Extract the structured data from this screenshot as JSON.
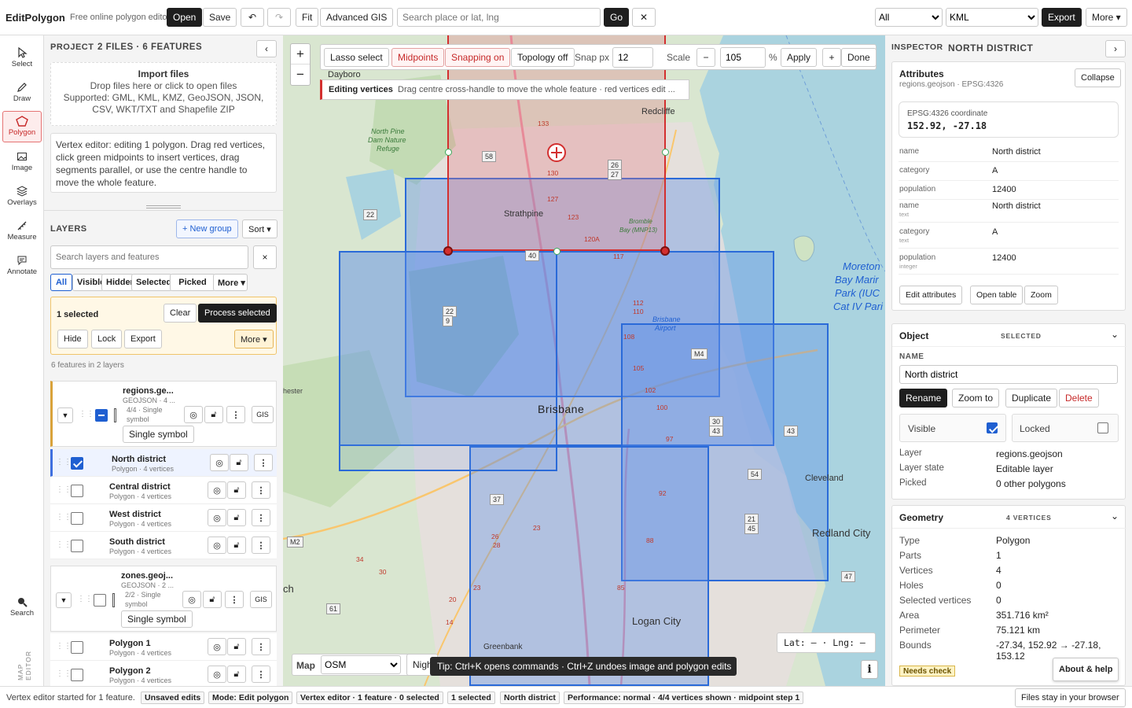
{
  "topbar": {
    "brand": "EditPolygon",
    "tagline": "Free online polygon editor",
    "open": "Open",
    "save": "Save",
    "undo": "↶",
    "redo": "↷",
    "fit": "Fit",
    "advanced": "Advanced GIS",
    "search_placeholder": "Search place or lat, lng",
    "go": "Go",
    "clear": "✕",
    "filter": "All",
    "format": "KML",
    "export": "Export",
    "more": "More ▾"
  },
  "rail": {
    "select": "Select",
    "draw": "Draw",
    "polygon": "Polygon",
    "image": "Image",
    "overlays": "Overlays",
    "measure": "Measure",
    "annotate": "Annotate",
    "search": "Search",
    "vertical": "MAP EDITOR"
  },
  "project": {
    "label": "PROJECT",
    "summary": "2 FILES · 6 FEATURES",
    "collapse": "‹",
    "import_title": "Import files",
    "import_line1": "Drop files here or click to open files",
    "import_line2": "Supported: GML, KML, KMZ, GeoJSON, JSON, CSV, WKT/TXT and Shapefile ZIP",
    "hint": "Vertex editor: editing 1 polygon. Drag red vertices, click green midpoints to insert vertices, drag segments parallel, or use the centre handle to move the whole feature."
  },
  "layers": {
    "label": "LAYERS",
    "new_group": "+ New group",
    "sort": "Sort ▾",
    "search_placeholder": "Search layers and features",
    "search_clear": "×",
    "filters": [
      "All",
      "Visible",
      "Hidden",
      "Selected",
      "Picked",
      "More ▾"
    ],
    "selected_count": "1 selected",
    "clear": "Clear",
    "process": "Process selected",
    "hide": "Hide",
    "lock": "Lock",
    "export": "Export",
    "more": "More ▾",
    "count_text": "6 features in 2 layers",
    "groups": [
      {
        "name": "regions.ge...",
        "meta": "GEOJSON · 4 ...",
        "meta2": "4/4 · Single",
        "meta3": "symbol",
        "symbol": "Single symbol",
        "gis": "GIS"
      },
      {
        "name": "zones.geoj...",
        "meta": "GEOJSON · 2 ...",
        "meta2": "2/2 · Single",
        "meta3": "symbol",
        "symbol": "Single symbol",
        "gis": "GIS"
      }
    ],
    "features": [
      {
        "name": "North district",
        "sub": "Polygon · 4 vertices"
      },
      {
        "name": "Central district",
        "sub": "Polygon · 4 vertices"
      },
      {
        "name": "West district",
        "sub": "Polygon · 4 vertices"
      },
      {
        "name": "South district",
        "sub": "Polygon · 4 vertices"
      },
      {
        "name": "Polygon 1",
        "sub": "Polygon · 4 vertices"
      },
      {
        "name": "Polygon 2",
        "sub": "Polygon · 4 vertices"
      }
    ]
  },
  "map": {
    "zoom_in": "+",
    "zoom_out": "−",
    "lasso": "Lasso select",
    "midpoints": "Midpoints",
    "snapping": "Snapping on",
    "topology": "Topology off",
    "snap_label": "Snap px",
    "snap_value": "12",
    "scale_label": "Scale",
    "scale_minus": "−",
    "scale_value": "105",
    "scale_unit": "%",
    "apply": "Apply",
    "plus": "+",
    "done": "Done",
    "editing_title": "Editing vertices",
    "editing_text": "Drag centre cross-handle to move the whole feature · red vertices edit ...",
    "coords": "Lat: — · Lng: —",
    "basemap_label": "Map",
    "basemap": "OSM",
    "night": "Nigh",
    "tip": "Tip: Ctrl+K opens commands · Ctrl+Z undoes image and polygon edits",
    "info": "i",
    "places": [
      "Dayboro",
      "Redcliffe",
      "Strathpine",
      "Brisbane",
      "Cleveland",
      "Redland City",
      "Logan City",
      "Greenbank",
      "Moreton",
      "Bay Marir",
      "Park (IUC",
      "Cat IV Pari",
      "North Pine",
      "Dam Nature",
      "Refuge",
      "Brisbane",
      "Airport",
      "Bromble",
      "Bay (MNP13)",
      "hester",
      "ch"
    ],
    "shields": [
      "58",
      "22",
      "26",
      "27",
      "40",
      "22",
      "9",
      "M4",
      "30",
      "43",
      "43",
      "54",
      "37",
      "21",
      "45",
      "M2",
      "61",
      "47",
      "133",
      "130",
      "127",
      "123",
      "120A",
      "117",
      "112",
      "110",
      "108",
      "105",
      "102",
      "100",
      "97",
      "92",
      "88",
      "85",
      "23",
      "26",
      "28",
      "34",
      "30",
      "23",
      "20",
      "14"
    ]
  },
  "inspector": {
    "label": "INSPECTOR",
    "title": "NORTH DISTRICT",
    "close": "›",
    "attr_title": "Attributes",
    "attr_sub": "regions.geojson · EPSG:4326",
    "collapse": "Collapse",
    "coord_label": "EPSG:4326 coordinate",
    "coord_value": "152.92, -27.18",
    "attrs": [
      {
        "k": "name",
        "t": "",
        "v": "North district"
      },
      {
        "k": "category",
        "t": "",
        "v": "A"
      },
      {
        "k": "population",
        "t": "",
        "v": "12400"
      },
      {
        "k": "name",
        "t": "text",
        "v": "North district"
      },
      {
        "k": "category",
        "t": "text",
        "v": "A"
      },
      {
        "k": "population",
        "t": "integer",
        "v": "12400"
      }
    ],
    "edit_attrs": "Edit attributes",
    "open_table": "Open table",
    "zoom": "Zoom",
    "object_title": "Object",
    "object_state": "SELECTED",
    "name_label": "NAME",
    "name_value": "North district",
    "rename": "Rename",
    "zoom_to": "Zoom to",
    "duplicate": "Duplicate",
    "delete": "Delete",
    "visible": "Visible",
    "locked": "Locked",
    "layer_k": "Layer",
    "layer_v": "regions.geojson",
    "state_k": "Layer state",
    "state_v": "Editable layer",
    "picked_k": "Picked",
    "picked_v": "0 other polygons",
    "geom_title": "Geometry",
    "geom_count": "4 VERTICES",
    "geom": [
      {
        "k": "Type",
        "v": "Polygon"
      },
      {
        "k": "Parts",
        "v": "1"
      },
      {
        "k": "Vertices",
        "v": "4"
      },
      {
        "k": "Holes",
        "v": "0"
      },
      {
        "k": "Selected vertices",
        "v": "0"
      },
      {
        "k": "Area",
        "v": "351.716 km²"
      },
      {
        "k": "Perimeter",
        "v": "75.121 km"
      },
      {
        "k": "Bounds",
        "v": "-27.34, 152.92 → -27.18,"
      },
      {
        "k": "",
        "v": "153.12"
      }
    ],
    "needs_check": "Needs check",
    "about": "About & help"
  },
  "status": {
    "message": "Vertex editor started for 1 feature.",
    "chips": [
      "Unsaved edits",
      "Mode: Edit polygon",
      "Vertex editor · 1 feature · 0 selected",
      "1 selected",
      "North district",
      "Performance: normal · 4/4 vertices shown · midpoint step 1"
    ],
    "local": "Files stay in your browser"
  },
  "colors": {
    "accent": "#1f5fd1",
    "edit": "#d32f2f",
    "dark": "#1e1e1e",
    "polygon_fill": "#5b8de8",
    "midpoint": "#3caa5a"
  }
}
